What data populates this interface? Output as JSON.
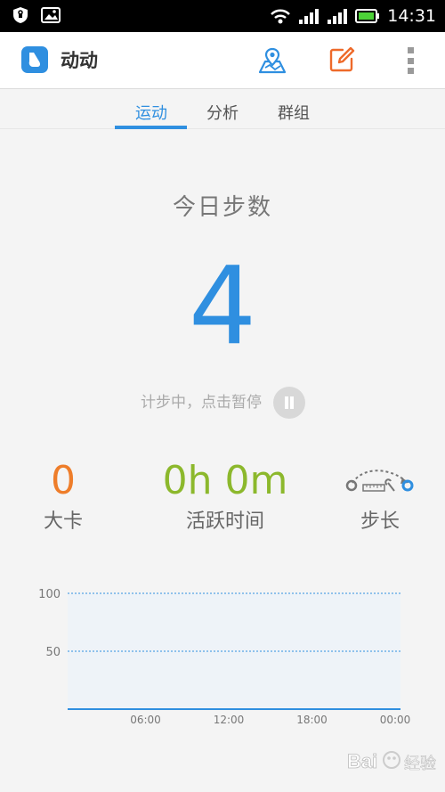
{
  "status_bar": {
    "time": "14:31",
    "icons": [
      "shield-icon",
      "gallery-icon",
      "wifi-icon",
      "signal-icon",
      "signal-icon",
      "battery-icon"
    ]
  },
  "app_bar": {
    "title": "动动",
    "icons": [
      "shoe-logo-icon",
      "map-location-icon",
      "edit-icon",
      "overflow-menu-icon"
    ]
  },
  "tabs": [
    {
      "label": "运动",
      "active": true
    },
    {
      "label": "分析",
      "active": false
    },
    {
      "label": "群组",
      "active": false
    }
  ],
  "today": {
    "label": "今日步数",
    "steps": "4",
    "status_text": "计步中，点击暂停"
  },
  "stats": {
    "calories_value": "0",
    "calories_label": "大卡",
    "active_time_value": "0h 0m",
    "active_time_label": "活跃时间",
    "stride_label": "步长"
  },
  "colors": {
    "accent_blue": "#2f8fe0",
    "calorie_orange": "#ee7d2a",
    "active_green": "#8cb82c"
  },
  "chart_data": {
    "type": "area",
    "x_ticks": [
      "06:00",
      "12:00",
      "18:00",
      "00:00"
    ],
    "y_ticks": [
      100,
      50
    ],
    "ylim": [
      0,
      100
    ],
    "series": [
      {
        "values": [
          0,
          0,
          0,
          0,
          0
        ]
      }
    ],
    "grid": true
  },
  "watermark": {
    "text": "Bai 经验"
  }
}
